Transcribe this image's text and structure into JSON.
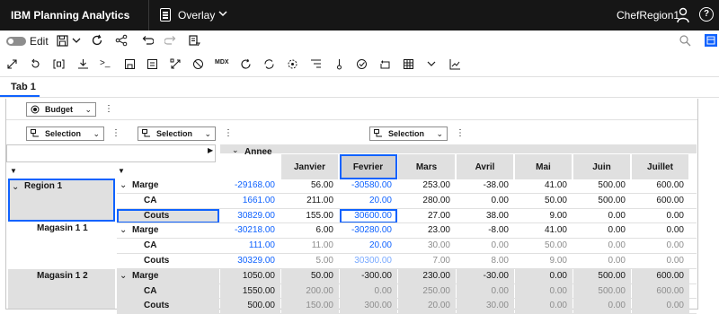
{
  "topbar": {
    "brand": "IBM Planning Analytics",
    "workspace": "Overlay",
    "user": "ChefRegion1"
  },
  "toolbar": {
    "edit_label": "Edit",
    "mdx_label": "MDX"
  },
  "tabs": [
    {
      "label": "Tab 1"
    }
  ],
  "context": {
    "budget": "Budget",
    "selection": "Selection"
  },
  "grid": {
    "column_dimension": "Annee",
    "columns": [
      "Janvier",
      "Fevrier",
      "Mars",
      "Avril",
      "Mai",
      "Juin",
      "Juillet"
    ],
    "row_labels": {
      "region1": "Region 1",
      "magasin11": "Magasin 1 1",
      "magasin12": "Magasin 1 2",
      "marge": "Marge",
      "ca": "CA",
      "couts": "Couts"
    },
    "rows": [
      {
        "total": "-29168.00",
        "values": [
          "56.00",
          "-30580.00",
          "253.00",
          "-38.00",
          "41.00",
          "500.00",
          "600.00"
        ]
      },
      {
        "total": "1661.00",
        "values": [
          "211.00",
          "20.00",
          "280.00",
          "0.00",
          "50.00",
          "500.00",
          "600.00"
        ]
      },
      {
        "total": "30829.00",
        "values": [
          "155.00",
          "30600.00",
          "27.00",
          "38.00",
          "9.00",
          "0.00",
          "0.00"
        ]
      },
      {
        "total": "-30218.00",
        "values": [
          "6.00",
          "-30280.00",
          "23.00",
          "-8.00",
          "41.00",
          "0.00",
          "0.00"
        ]
      },
      {
        "total": "111.00",
        "values": [
          "11.00",
          "20.00",
          "30.00",
          "0.00",
          "50.00",
          "0.00",
          "0.00"
        ]
      },
      {
        "total": "30329.00",
        "values": [
          "5.00",
          "30300.00",
          "7.00",
          "8.00",
          "9.00",
          "0.00",
          "0.00"
        ]
      },
      {
        "total": "1050.00",
        "values": [
          "50.00",
          "-300.00",
          "230.00",
          "-30.00",
          "0.00",
          "500.00",
          "600.00"
        ]
      },
      {
        "total": "1550.00",
        "values": [
          "200.00",
          "0.00",
          "250.00",
          "0.00",
          "0.00",
          "500.00",
          "600.00"
        ]
      },
      {
        "total": "500.00",
        "values": [
          "150.00",
          "300.00",
          "20.00",
          "30.00",
          "0.00",
          "0.00",
          "0.00"
        ]
      }
    ]
  },
  "colors": {
    "accent": "#0f62fe",
    "header_gray": "#e0e0e0",
    "topbar": "#161616"
  }
}
